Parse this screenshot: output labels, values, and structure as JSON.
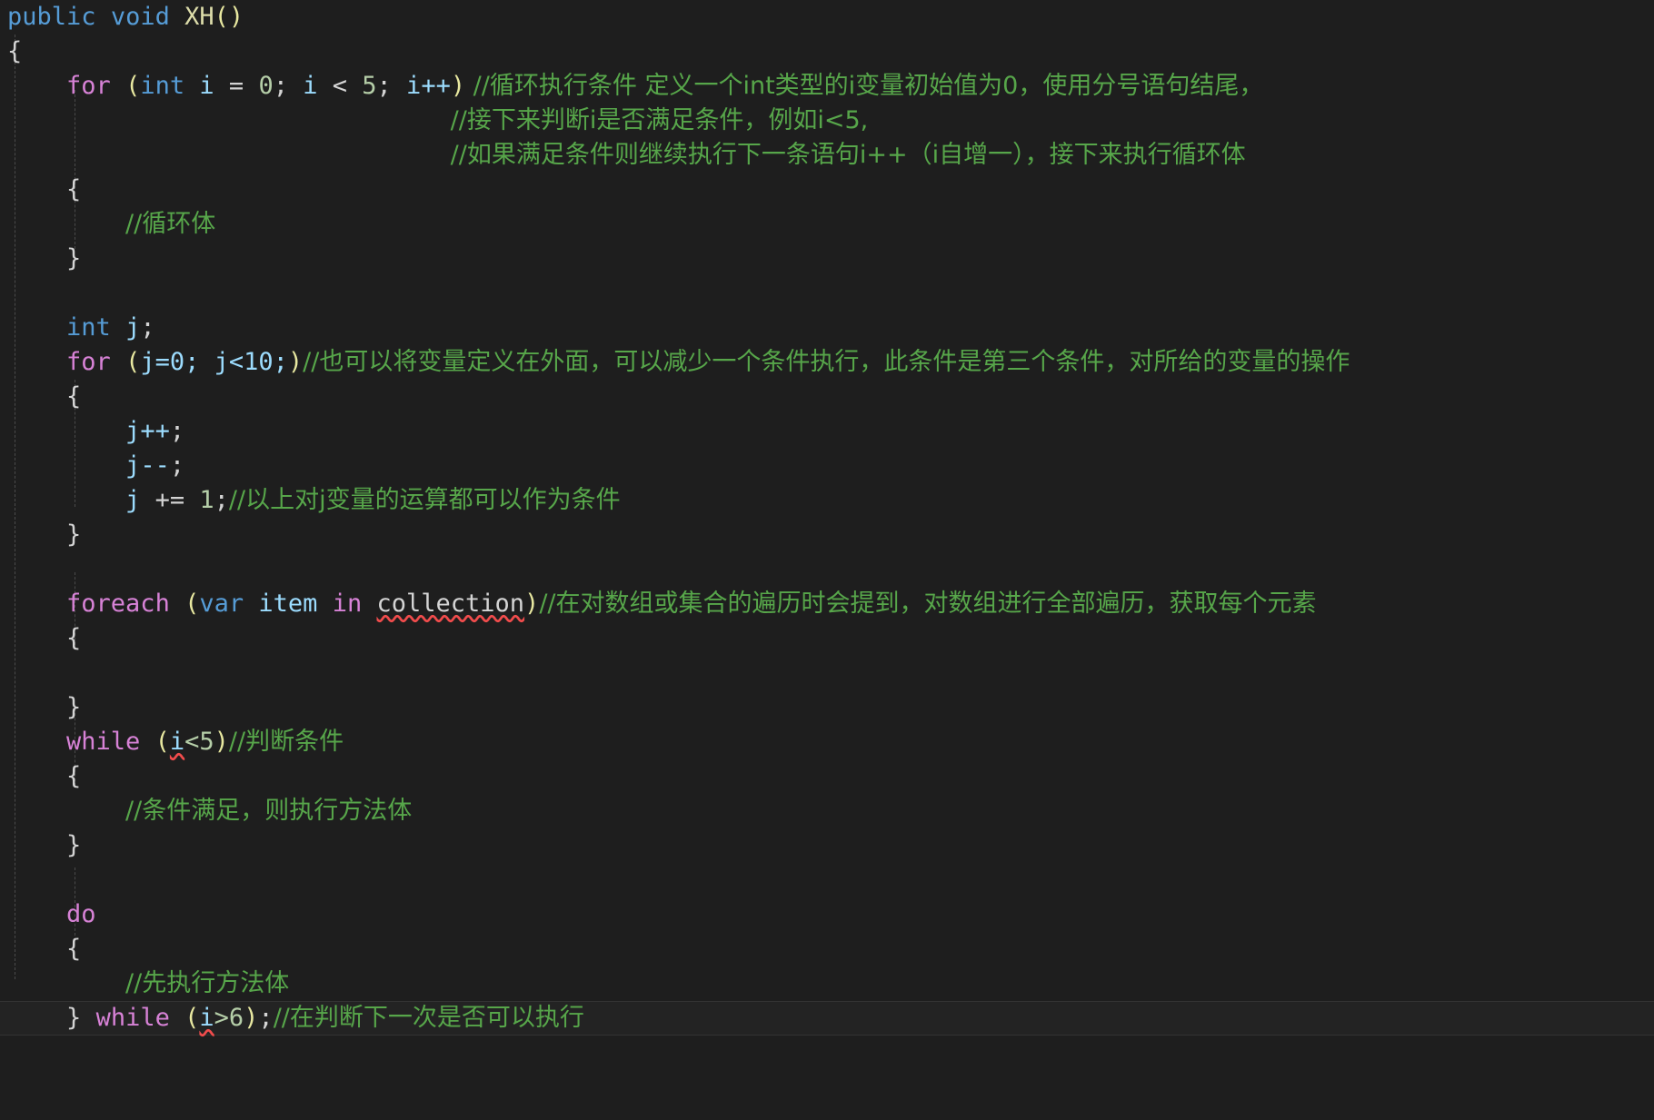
{
  "editor": {
    "language": "csharp",
    "theme": "dark-plus",
    "background": "#1e1e1e",
    "foreground": "#d4d4d4",
    "comment_color": "#57a64a",
    "keyword_color": "#d782d6",
    "type_color": "#569cd6",
    "method_color": "#dcdcaa",
    "identifier_color": "#9cdcfe",
    "number_color": "#b5cea8",
    "error_squiggle_color": "#f14c4c",
    "current_line_background": "#232323"
  },
  "code": {
    "line01": {
      "kw_public": "public",
      "kw_void": "void",
      "method": "XH",
      "parens": "()"
    },
    "line02": {
      "brace": "{"
    },
    "line03": {
      "kw_for": "for",
      "open": "(",
      "type_int": "int",
      "var_i": "i",
      "eq": " = ",
      "zero": "0",
      "semi1": "; ",
      "var_i2": "i",
      "lt": " < ",
      "five": "5",
      "semi2": "; ",
      "var_i3": "i",
      "incr": "++",
      "close": ")",
      "comment": " //循环执行条件 定义一个int类型的i变量初始值为0，使用分号语句结尾，"
    },
    "line04": {
      "comment": "//接下来判断i是否满足条件，例如i<5,"
    },
    "line05": {
      "comment": "//如果满足条件则继续执行下一条语句i++（i自增一），接下来执行循环体"
    },
    "line06": {
      "brace": "{"
    },
    "line07": {
      "comment": "//循环体"
    },
    "line08": {
      "brace": "}"
    },
    "line09": {
      "text": ""
    },
    "line10": {
      "type_int": "int",
      "var_j": "j",
      "semi": ";"
    },
    "line11": {
      "kw_for": "for",
      "open": "(",
      "expr": "j=0; j<10;",
      "close": ")",
      "comment": "//也可以将变量定义在外面，可以减少一个条件执行，此条件是第三个条件，对所给的变量的操作"
    },
    "line12": {
      "brace": "{"
    },
    "line13": {
      "var_j": "j",
      "op": "++",
      "semi": ";"
    },
    "line14": {
      "var_j": "j",
      "op": "--",
      "semi": ";"
    },
    "line15": {
      "var_j": "j",
      "op": " += ",
      "one": "1",
      "semi": ";",
      "comment": "//以上对j变量的运算都可以作为条件"
    },
    "line16": {
      "brace": "}"
    },
    "line17": {
      "text": ""
    },
    "line18": {
      "kw_foreach": "foreach",
      "open": "(",
      "kw_var": "var",
      "item": "item",
      "kw_in": "in",
      "collection": "collection",
      "close": ")",
      "comment": "//在对数组或集合的遍历时会提到，对数组进行全部遍历，获取每个元素"
    },
    "line19": {
      "brace": "{"
    },
    "line20": {
      "text": ""
    },
    "line21": {
      "brace": "}"
    },
    "line22": {
      "kw_while": "while",
      "open": "(",
      "var_i": "i",
      "cond": "<5",
      "close": ")",
      "comment": "//判断条件"
    },
    "line23": {
      "brace": "{"
    },
    "line24": {
      "comment": "//条件满足，则执行方法体"
    },
    "line25": {
      "brace": "}"
    },
    "line26": {
      "text": ""
    },
    "line27": {
      "kw_do": "do"
    },
    "line28": {
      "brace": "{"
    },
    "line29": {
      "comment": "//先执行方法体"
    },
    "line30": {
      "brace": "}",
      "kw_while": "while",
      "open": "(",
      "var_i": "i",
      "cond": ">6",
      "close": ")",
      "semi": ";",
      "comment": "//在判断下一次是否可以执行"
    }
  }
}
